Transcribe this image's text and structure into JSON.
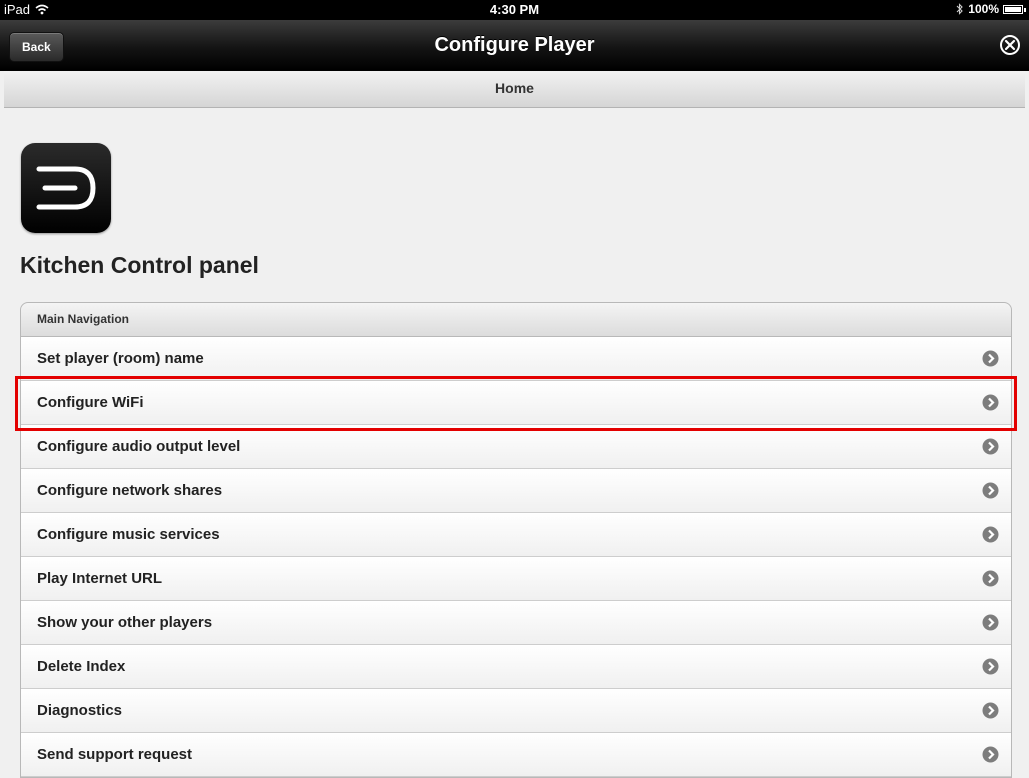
{
  "status_bar": {
    "device": "iPad",
    "time": "4:30 PM",
    "battery": "100%"
  },
  "nav": {
    "back_label": "Back",
    "title": "Configure Player"
  },
  "breadcrumb": "Home",
  "page_title": "Kitchen Control panel",
  "menu": {
    "header": "Main Navigation",
    "items": [
      {
        "label": "Set player (room) name"
      },
      {
        "label": "Configure WiFi"
      },
      {
        "label": "Configure audio output level"
      },
      {
        "label": "Configure network shares"
      },
      {
        "label": "Configure music services"
      },
      {
        "label": "Play Internet URL"
      },
      {
        "label": "Show your other players"
      },
      {
        "label": "Delete Index"
      },
      {
        "label": "Diagnostics"
      },
      {
        "label": "Send support request"
      }
    ]
  },
  "highlight_color": "#e30000"
}
